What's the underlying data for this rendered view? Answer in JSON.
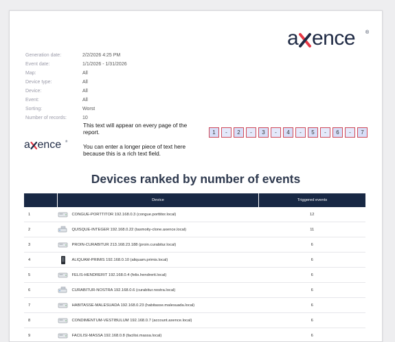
{
  "brand": {
    "logo_text": "axence",
    "logo_mark": "®"
  },
  "meta": [
    {
      "label": "Generation date:",
      "value": "2/2/2026 4:25 PM"
    },
    {
      "label": "Event date:",
      "value": "1/1/2026 - 1/31/2026"
    },
    {
      "label": "Map:",
      "value": "All"
    },
    {
      "label": "Device type:",
      "value": "All"
    },
    {
      "label": "Device:",
      "value": "All"
    },
    {
      "label": "Event:",
      "value": "All"
    },
    {
      "label": "Sorting:",
      "value": "Worst"
    },
    {
      "label": "Number of records:",
      "value": "10"
    }
  ],
  "header_text": {
    "line1": "This text will appear on every page of the report.",
    "line2": "You can enter a longer piece of text here because this is a rich text field."
  },
  "pager": [
    "1",
    "-",
    "2",
    "-",
    "3",
    "-",
    "4",
    "-",
    "5",
    "-",
    "6",
    "-",
    "7"
  ],
  "report_title": "Devices ranked by number of events",
  "table": {
    "columns": [
      "",
      "Device",
      "Triggered events"
    ],
    "rows": [
      {
        "index": "1",
        "device": "CONGUE-PORTTITOR  192.168.0.3  (congue.porttitor.local)",
        "events": "12",
        "icon": "server-icon"
      },
      {
        "index": "2",
        "device": "QUISQUE-INTEGER  192.168.0.22  (tasmoity-clone.axence.local)",
        "events": "11",
        "icon": "switch-icon"
      },
      {
        "index": "3",
        "device": "PROIN-CURABITUR  213.168.23.188  (proin.curabitur.local)",
        "events": "6",
        "icon": "server-icon"
      },
      {
        "index": "4",
        "device": "ALIQUAM-PRIMIS  192.168.0.10  (aliquam.primis.local)",
        "events": "6",
        "icon": "phone-icon"
      },
      {
        "index": "5",
        "device": "FELIS-HENDRERIT  192.168.0.4  (felis.hendrerit.local)",
        "events": "6",
        "icon": "server-icon"
      },
      {
        "index": "6",
        "device": "CURABITUR-NOSTRA  192.168.0.6  (curabitur.nostra.local)",
        "events": "6",
        "icon": "switch-icon"
      },
      {
        "index": "7",
        "device": "HABITASSE-MALESUADA  192.168.0.23  (habitasse.malesuada.local)",
        "events": "6",
        "icon": "server-icon"
      },
      {
        "index": "8",
        "device": "CONDIMENTUM-VESTIBULUM  192.168.0.7  (account.axence.local)",
        "events": "6",
        "icon": "server-icon"
      },
      {
        "index": "9",
        "device": "FACILISI-MASSA  192.168.0.8  (facilisi.massa.local)",
        "events": "6",
        "icon": "server-icon"
      }
    ]
  }
}
